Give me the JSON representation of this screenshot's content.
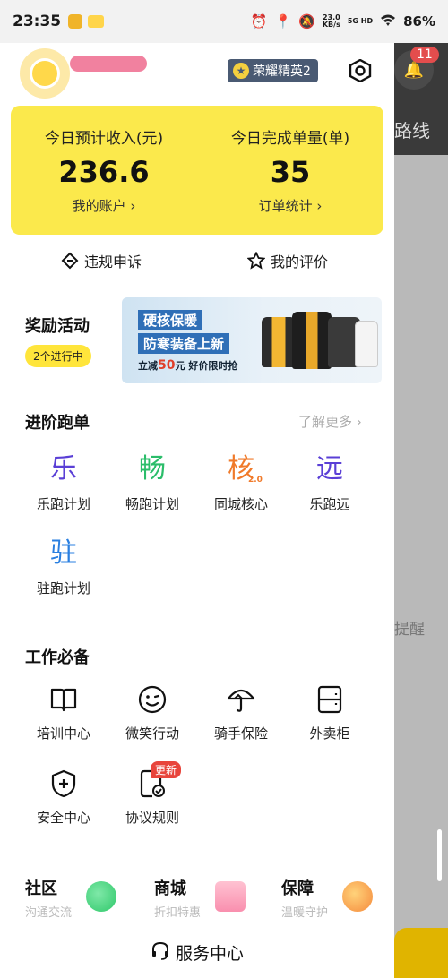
{
  "status_bar": {
    "time": "23:35",
    "speed": "23.0",
    "speed_unit": "KB/s",
    "network": "5G HD",
    "battery": "86%"
  },
  "background": {
    "route_text": "路线",
    "remind_text": "提醒",
    "notification_count": "11"
  },
  "header": {
    "rank_label": "荣耀精英2"
  },
  "stats": {
    "income_label": "今日预计收入(元)",
    "income_value": "236.6",
    "account_link": "我的账户",
    "orders_label": "今日完成单量(单)",
    "orders_value": "35",
    "orders_link": "订单统计"
  },
  "quick_links": {
    "appeal": "违规申诉",
    "reviews": "我的评价"
  },
  "rewards": {
    "title": "奖励活动",
    "pill": "2个进行中",
    "banner_line1": "硬核保暖",
    "banner_line2": "防寒装备上新",
    "banner_line3_prefix": "立减",
    "banner_line3_amount": "50",
    "banner_line3_suffix": "元 好价限时抢"
  },
  "advanced": {
    "title": "进阶跑单",
    "more": "了解更多",
    "items": [
      {
        "glyph": "乐",
        "label": "乐跑计划",
        "color": "#5a3fd6"
      },
      {
        "glyph": "畅",
        "label": "畅跑计划",
        "color": "#2bbd6a"
      },
      {
        "glyph": "核",
        "label": "同城核心",
        "color": "#f07a2a"
      },
      {
        "glyph": "远",
        "label": "乐跑远",
        "color": "#5a3fd6"
      },
      {
        "glyph": "驻",
        "label": "驻跑计划",
        "color": "#2a7fe0"
      }
    ],
    "hub_version": "2.0"
  },
  "work": {
    "title": "工作必备",
    "items": [
      {
        "label": "培训中心",
        "icon": "book-icon"
      },
      {
        "label": "微笑行动",
        "icon": "smile-icon"
      },
      {
        "label": "骑手保险",
        "icon": "umbrella-icon"
      },
      {
        "label": "外卖柜",
        "icon": "cabinet-icon"
      },
      {
        "label": "安全中心",
        "icon": "shield-plus-icon"
      },
      {
        "label": "协议规则",
        "icon": "document-check-icon"
      }
    ],
    "update_badge": "更新"
  },
  "bottom": {
    "community_title": "社区",
    "community_sub": "沟通交流",
    "mall_title": "商城",
    "mall_sub": "折扣特惠",
    "protection_title": "保障",
    "protection_sub": "温暖守护"
  },
  "service": {
    "label": "服务中心"
  }
}
